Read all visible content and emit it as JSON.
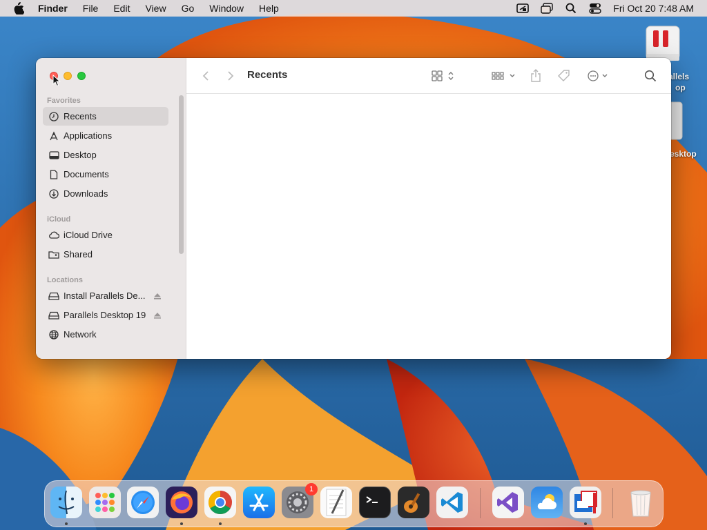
{
  "menubar": {
    "app_name": "Finder",
    "menus": [
      "File",
      "Edit",
      "View",
      "Go",
      "Window",
      "Help"
    ],
    "clock": "Fri Oct 20  7:48 AM",
    "status_icons": [
      "parallels-menu-icon",
      "screen-mirroring-icon",
      "spotlight-search-icon",
      "control-center-icon"
    ]
  },
  "desktop": {
    "icons": [
      {
        "label_line1": "allels",
        "label_line2": "op",
        "icon": "parallels-installer-icon"
      },
      {
        "label": "esktop",
        "icon": "disk-image-icon"
      }
    ]
  },
  "window": {
    "title": "Recents",
    "sidebar": {
      "sections": [
        {
          "title": "Favorites",
          "items": [
            {
              "label": "Recents",
              "icon": "clock-icon",
              "active": true
            },
            {
              "label": "Applications",
              "icon": "applications-icon"
            },
            {
              "label": "Desktop",
              "icon": "desktop-icon"
            },
            {
              "label": "Documents",
              "icon": "document-icon"
            },
            {
              "label": "Downloads",
              "icon": "download-icon"
            }
          ]
        },
        {
          "title": "iCloud",
          "items": [
            {
              "label": "iCloud Drive",
              "icon": "cloud-icon"
            },
            {
              "label": "Shared",
              "icon": "shared-folder-icon"
            }
          ]
        },
        {
          "title": "Locations",
          "items": [
            {
              "label": "Install Parallels De...",
              "icon": "drive-icon",
              "eject": true
            },
            {
              "label": "Parallels Desktop 19",
              "icon": "drive-icon",
              "eject": true
            },
            {
              "label": "Network",
              "icon": "globe-icon"
            }
          ]
        }
      ]
    },
    "toolbar": {
      "buttons": [
        "back-icon",
        "forward-icon",
        "icon-view-icon",
        "group-icon",
        "share-icon",
        "tag-icon",
        "more-actions-icon",
        "search-icon"
      ]
    }
  },
  "dock": {
    "apps": [
      {
        "name": "Finder",
        "icon": "finder-icon",
        "running": true
      },
      {
        "name": "Launchpad",
        "icon": "launchpad-icon"
      },
      {
        "name": "Safari",
        "icon": "safari-icon"
      },
      {
        "name": "Firefox",
        "icon": "firefox-icon",
        "running": true
      },
      {
        "name": "Chrome",
        "icon": "chrome-icon",
        "running": true
      },
      {
        "name": "App Store",
        "icon": "app-store-icon"
      },
      {
        "name": "System Settings",
        "icon": "system-settings-icon",
        "badge": "1"
      },
      {
        "name": "TextEdit",
        "icon": "textedit-icon"
      },
      {
        "name": "Terminal",
        "icon": "terminal-icon"
      },
      {
        "name": "GarageBand",
        "icon": "garageband-icon"
      },
      {
        "name": "Visual Studio Code",
        "icon": "vscode-icon"
      },
      {
        "name": "Visual Studio",
        "icon": "visual-studio-icon"
      },
      {
        "name": "Weather",
        "icon": "weather-icon"
      },
      {
        "name": "Parallels Desktop",
        "icon": "parallels-icon",
        "running": true
      },
      {
        "name": "Trash",
        "icon": "trash-icon"
      }
    ]
  },
  "colors": {
    "accent_close": "#ff5f57",
    "accent_min": "#febc2e",
    "accent_max": "#28c840",
    "badge": "#ff3b30"
  }
}
